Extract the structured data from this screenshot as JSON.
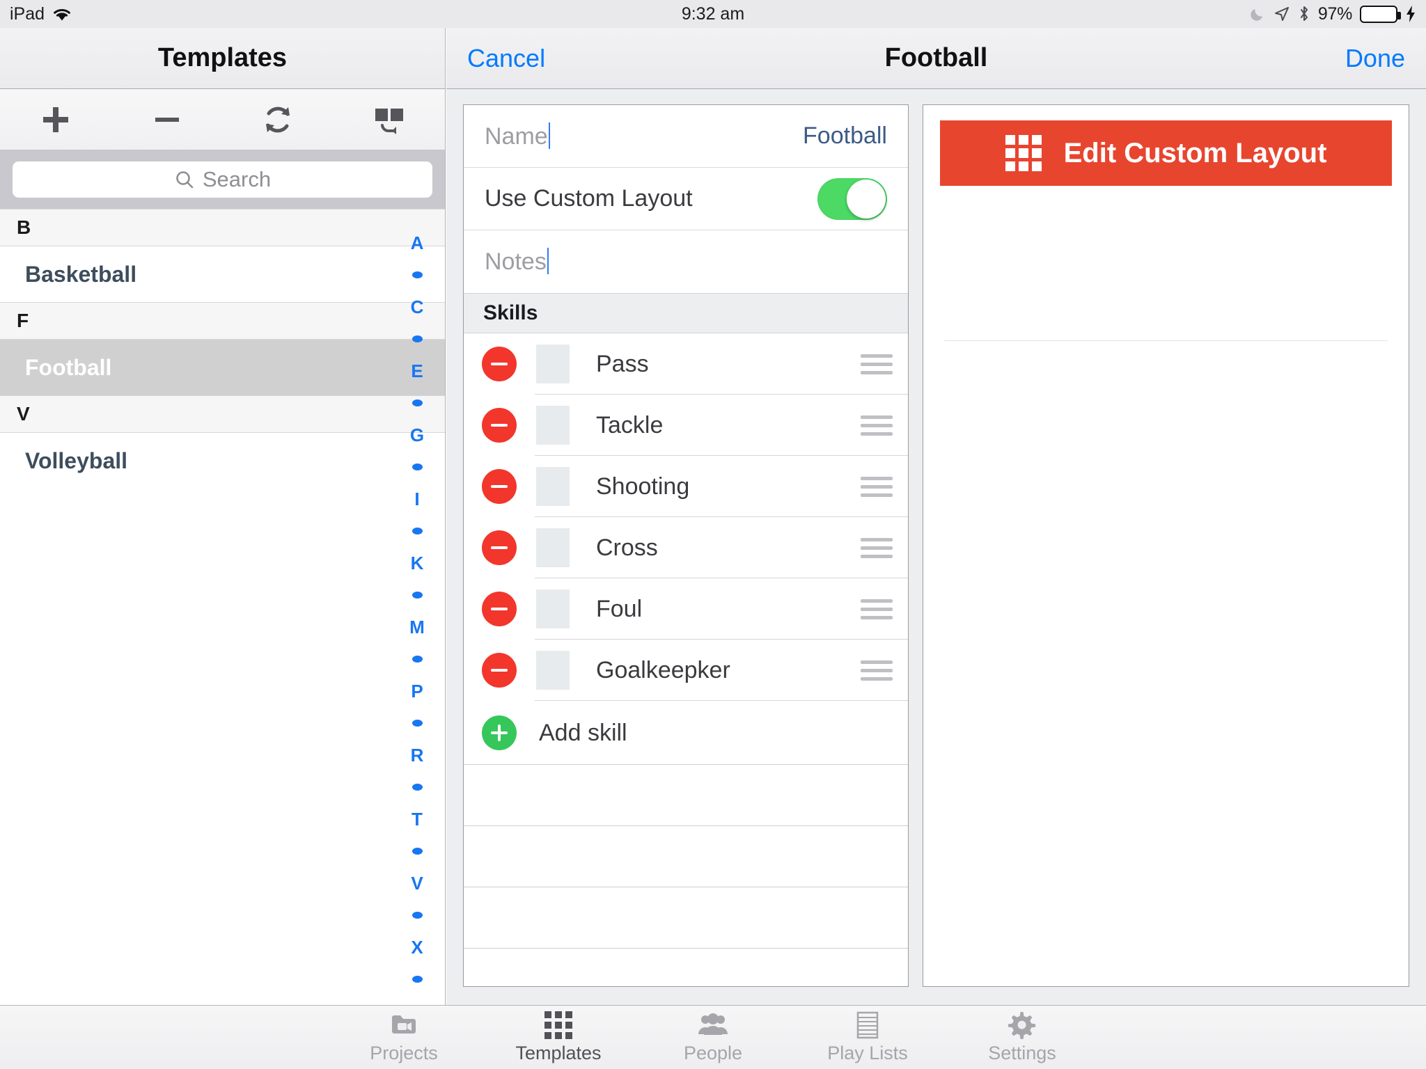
{
  "statusbar": {
    "device": "iPad",
    "wifi_icon": "wifi-icon",
    "time": "9:32 am",
    "moon_icon": "moon-icon",
    "location_icon": "location-arrow-icon",
    "bluetooth_icon": "bluetooth-icon",
    "battery_percent": "97%",
    "battery_level": 97,
    "charging_icon": "lightning-bolt-icon"
  },
  "sidebar": {
    "title": "Templates",
    "toolbar": [
      {
        "name": "add-template-button",
        "icon": "plus-icon"
      },
      {
        "name": "remove-template-button",
        "icon": "minus-icon"
      },
      {
        "name": "refresh-button",
        "icon": "refresh-icon"
      },
      {
        "name": "restore-layout-button",
        "icon": "columns-restore-icon"
      }
    ],
    "search": {
      "placeholder": "Search",
      "value": "",
      "icon": "search-icon"
    },
    "sections": [
      {
        "letter": "B",
        "items": [
          {
            "label": "Basketball",
            "selected": false
          }
        ]
      },
      {
        "letter": "F",
        "items": [
          {
            "label": "Football",
            "selected": true
          }
        ]
      },
      {
        "letter": "V",
        "items": [
          {
            "label": "Volleyball",
            "selected": false
          }
        ]
      }
    ],
    "index_strip": [
      "A",
      "•",
      "C",
      "•",
      "E",
      "•",
      "G",
      "•",
      "I",
      "•",
      "K",
      "•",
      "M",
      "•",
      "P",
      "•",
      "R",
      "•",
      "T",
      "•",
      "V",
      "•",
      "X",
      "•"
    ]
  },
  "detail": {
    "nav": {
      "cancel_label": "Cancel",
      "title": "Football",
      "done_label": "Done"
    },
    "form": {
      "name_placeholder": "Name",
      "name_value": "Football",
      "custom_layout_label": "Use Custom Layout",
      "custom_layout_on": true,
      "notes_placeholder": "Notes",
      "notes_value": ""
    },
    "skills_section_title": "Skills",
    "skills": [
      {
        "label": "Pass",
        "swatch": "#e7ebed"
      },
      {
        "label": "Tackle",
        "swatch": "#e7ebed"
      },
      {
        "label": "Shooting",
        "swatch": "#e7ebed"
      },
      {
        "label": "Cross",
        "swatch": "#e7ebed"
      },
      {
        "label": "Foul",
        "swatch": "#e7ebed"
      },
      {
        "label": "Goalkeepker",
        "swatch": "#e7ebed"
      }
    ],
    "add_skill_label": "Add skill",
    "blank_row_count": 3,
    "right_panel": {
      "edit_layout_label": "Edit Custom Layout",
      "edit_layout_icon": "grid-3x3-icon",
      "edit_layout_color": "#e8452f"
    }
  },
  "tabbar": {
    "tabs": [
      {
        "label": "Projects",
        "icon": "folder-video-icon",
        "active": false
      },
      {
        "label": "Templates",
        "icon": "grid-3x3-icon",
        "active": true
      },
      {
        "label": "People",
        "icon": "people-icon",
        "active": false
      },
      {
        "label": "Play Lists",
        "icon": "list-icon",
        "active": false
      },
      {
        "label": "Settings",
        "icon": "gear-icon",
        "active": false
      }
    ]
  },
  "colors": {
    "accent_blue": "#007aff",
    "destructive_red": "#f2362c",
    "confirm_green": "#35c75a",
    "toggle_green": "#4cd964",
    "layout_red": "#e8452f"
  }
}
